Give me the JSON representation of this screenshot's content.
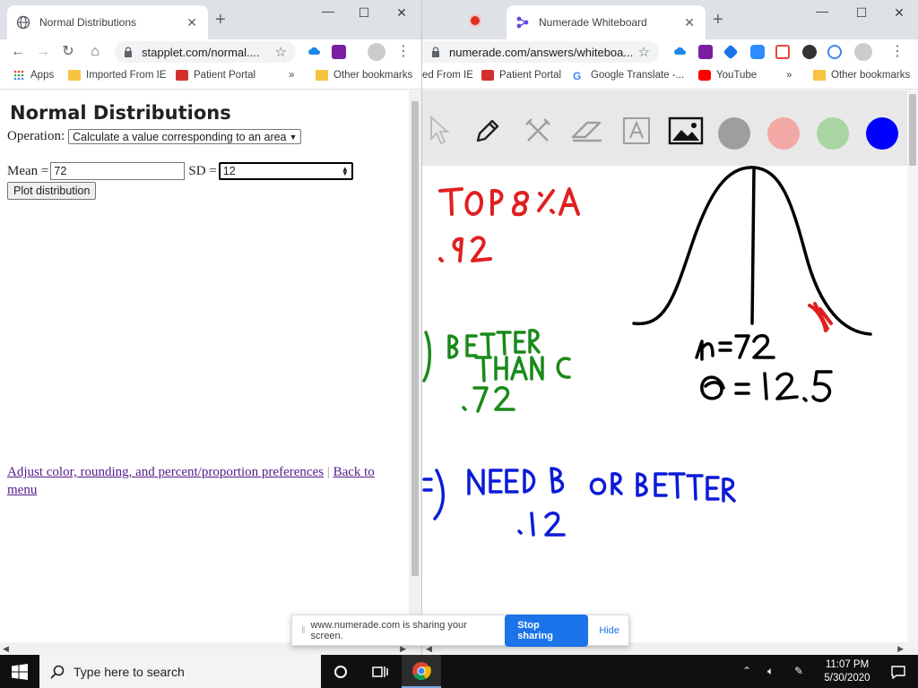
{
  "left_browser": {
    "tab": {
      "title": "Normal Distributions",
      "favicon": "globe-icon"
    },
    "omnibox": {
      "url": "stapplet.com/normal...."
    },
    "bookmarks": [
      {
        "label": "Apps",
        "icon": "apps-grid-icon"
      },
      {
        "label": "Imported From IE",
        "icon": "folder-icon"
      },
      {
        "label": "Patient Portal",
        "icon": "patient-portal-icon"
      },
      {
        "label": "»",
        "icon": ""
      },
      {
        "label": "Other bookmarks",
        "icon": "folder-icon"
      }
    ],
    "page": {
      "heading": "Normal Distributions",
      "operation_label": "Operation:",
      "operation_value": "Calculate a value corresponding to an area",
      "mean_label": "Mean =",
      "mean_value": "72",
      "sd_label": "SD =",
      "sd_value": "12",
      "plot_button": "Plot distribution",
      "link_preferences": "Adjust color, rounding, and percent/proportion preferences",
      "link_separator": "|",
      "link_back": "Back to menu"
    }
  },
  "right_browser": {
    "tab": {
      "title": "Numerade Whiteboard",
      "favicon": "numerade-icon"
    },
    "omnibox": {
      "url": "numerade.com/answers/whiteboa..."
    },
    "bookmarks": [
      {
        "label": "ed From IE",
        "icon": ""
      },
      {
        "label": "Patient Portal",
        "icon": "patient-portal-icon"
      },
      {
        "label": "Google Translate -...",
        "icon": "google-icon"
      },
      {
        "label": "YouTube",
        "icon": "youtube-icon"
      },
      {
        "label": "»",
        "icon": ""
      },
      {
        "label": "Other bookmarks",
        "icon": "folder-icon"
      }
    ],
    "whiteboard": {
      "tools": [
        "pointer-icon",
        "pen-icon",
        "tools-icon",
        "eraser-icon",
        "text-icon",
        "image-icon"
      ],
      "colors": [
        "#9e9e9e",
        "#f2a9a5",
        "#a8d5a2",
        "#0000ff"
      ],
      "handwriting": {
        "red": [
          "TOP 8% A",
          ".92"
        ],
        "green": [
          "BETTER",
          "THAN C",
          ".72"
        ],
        "blue": [
          "NEED B OR BETTER",
          ".12"
        ],
        "black": [
          "μ = 72",
          "σ = 12.5"
        ]
      }
    }
  },
  "share_bar": {
    "message": "www.numerade.com is sharing your screen.",
    "stop_label": "Stop sharing",
    "hide_label": "Hide"
  },
  "taskbar": {
    "search_placeholder": "Type here to search",
    "time": "11:07 PM",
    "date": "5/30/2020"
  }
}
